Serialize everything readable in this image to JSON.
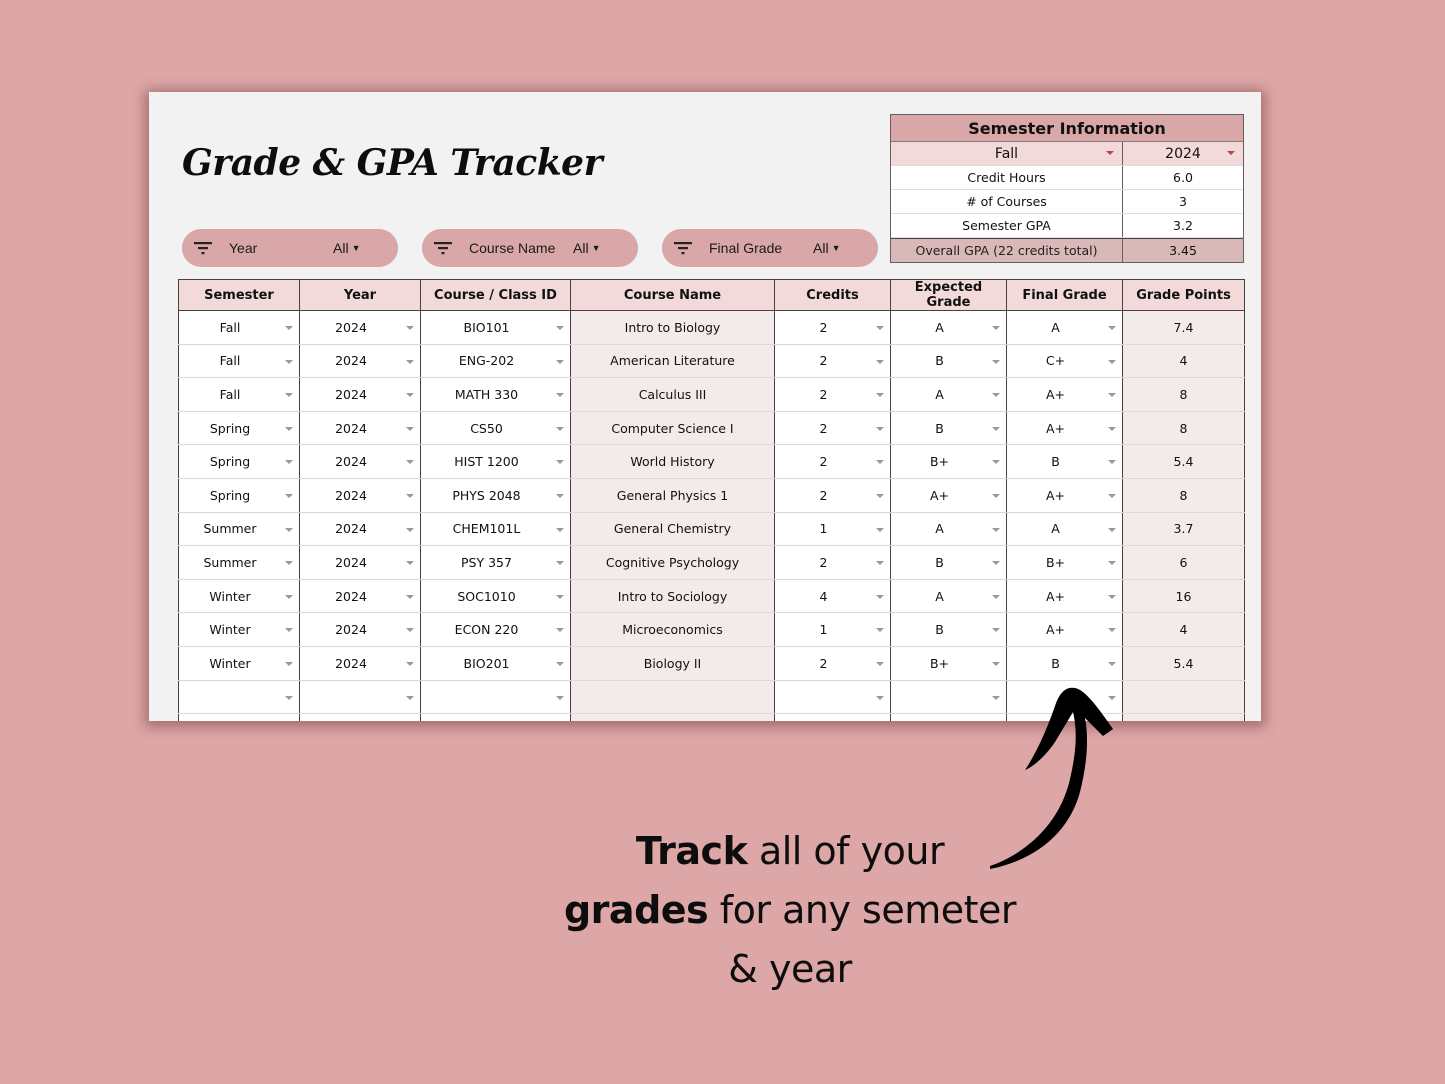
{
  "title": "Grade & GPA Tracker",
  "filters": [
    {
      "label": "Year",
      "value": "All",
      "icon": "filter-icon"
    },
    {
      "label": "Course Name",
      "value": "All",
      "icon": "filter-icon"
    },
    {
      "label": "Final Grade",
      "value": "All",
      "icon": "filter-icon"
    }
  ],
  "semester_info": {
    "header": "Semester Information",
    "selected_semester": "Fall",
    "selected_year": "2024",
    "rows": [
      {
        "label": "Credit Hours",
        "value": "6.0"
      },
      {
        "label": "# of Courses",
        "value": "3"
      },
      {
        "label": "Semester GPA",
        "value": "3.2"
      }
    ],
    "overall": {
      "label": "Overall GPA (22 credits total)",
      "value": "3.45"
    }
  },
  "table": {
    "columns": [
      "Semester",
      "Year",
      "Course / Class ID",
      "Course Name",
      "Credits",
      "Expected Grade",
      "Final Grade",
      "Grade Points"
    ],
    "rows": [
      [
        "Fall",
        "2024",
        "BIO101",
        "Intro to Biology",
        "2",
        "A",
        "A",
        "7.4"
      ],
      [
        "Fall",
        "2024",
        "ENG-202",
        "American Literature",
        "2",
        "B",
        "C+",
        "4"
      ],
      [
        "Fall",
        "2024",
        "MATH 330",
        "Calculus III",
        "2",
        "A",
        "A+",
        "8"
      ],
      [
        "Spring",
        "2024",
        "CS50",
        "Computer Science I",
        "2",
        "B",
        "A+",
        "8"
      ],
      [
        "Spring",
        "2024",
        "HIST 1200",
        "World History",
        "2",
        "B+",
        "B",
        "5.4"
      ],
      [
        "Spring",
        "2024",
        "PHYS 2048",
        "General Physics 1",
        "2",
        "A+",
        "A+",
        "8"
      ],
      [
        "Summer",
        "2024",
        "CHEM101L",
        "General Chemistry",
        "1",
        "A",
        "A",
        "3.7"
      ],
      [
        "Summer",
        "2024",
        "PSY 357",
        "Cognitive Psychology",
        "2",
        "B",
        "B+",
        "6"
      ],
      [
        "Winter",
        "2024",
        "SOC1010",
        "Intro to Sociology",
        "4",
        "A",
        "A+",
        "16"
      ],
      [
        "Winter",
        "2024",
        "ECON 220",
        "Microeconomics",
        "1",
        "B",
        "A+",
        "4"
      ],
      [
        "Winter",
        "2024",
        "BIO201",
        "Biology II",
        "2",
        "B+",
        "B",
        "5.4"
      ],
      [
        "",
        "",
        "",
        "",
        "",
        "",
        "",
        ""
      ],
      [
        "",
        "",
        "",
        "",
        "",
        "",
        "",
        ""
      ]
    ]
  },
  "caption": {
    "line1_bold": "Track",
    "line1_rest": " all of your",
    "line2_bold": "grades",
    "line2_rest": " for any semeter",
    "line3": "& year"
  },
  "colors": {
    "background": "#dea7a7",
    "accent_pink": "#d9a7a7",
    "header_pink": "#f2dada",
    "dropdown_red": "#c0404a"
  }
}
